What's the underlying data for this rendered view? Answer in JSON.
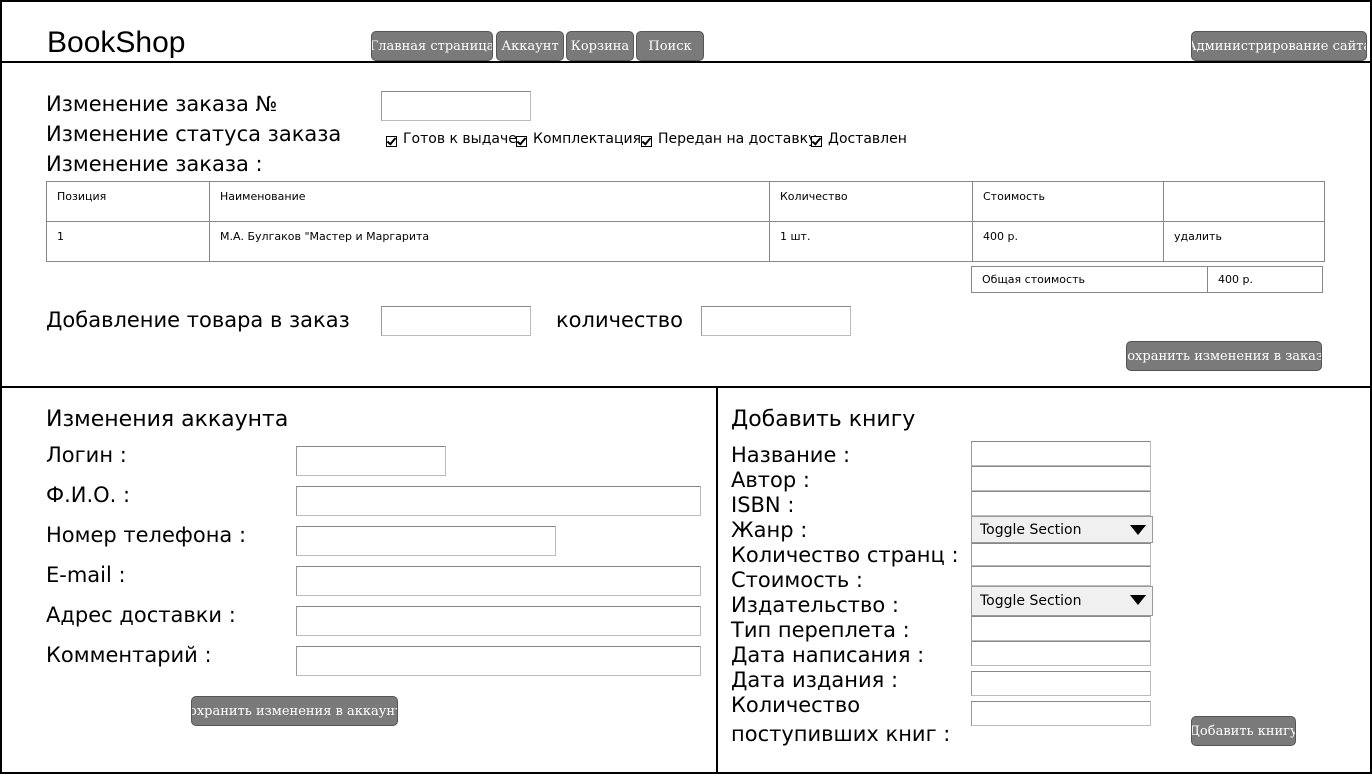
{
  "header": {
    "logo": "BookShop",
    "nav": [
      "Главная страница",
      "Аккаунт",
      "Корзина",
      "Поиск"
    ],
    "admin_button": "Администрирование сайта"
  },
  "order_edit": {
    "title_number": "Изменение заказа №",
    "title_status": "Изменение статуса заказа",
    "title_items": "Изменение заказа :",
    "statuses": [
      "Готов к выдаче",
      "Комплектация",
      "Передан на доставку",
      "Доставлен"
    ],
    "table": {
      "headers": [
        "Позиция",
        "Наименование",
        "Количество",
        "Стоимость",
        ""
      ],
      "rows": [
        [
          "1",
          "М.А. Булгаков \"Мастер и Маргарита",
          "1 шт.",
          "400 р.",
          "удалить"
        ]
      ]
    },
    "total_label": "Общая стоимость",
    "total_value": "400 р.",
    "add_label": "Добавление товара в заказ",
    "qty_label": "количество",
    "save_button": "Сохранить изменения в заказе"
  },
  "account": {
    "title": "Изменения аккаунта",
    "fields": [
      "Логин :",
      "Ф.И.О. :",
      "Номер телефона :",
      "E-mail :",
      "Адрес доставки :",
      "Комментарий :"
    ],
    "save_button": "Сохранить изменения в аккаунте"
  },
  "add_book": {
    "title": "Добавить книгу",
    "fields": [
      "Название :",
      "Автор :",
      "ISBN :",
      "Жанр :",
      "Количество странц :",
      "Стоимость :",
      "Издательство :",
      "Тип переплета :",
      "Дата написания :",
      "Дата издания :",
      "Количество",
      "поступивших книг :"
    ],
    "genre_select": "Toggle Section",
    "publisher_select": "Toggle Section",
    "submit_button": "Добавить книгу"
  }
}
